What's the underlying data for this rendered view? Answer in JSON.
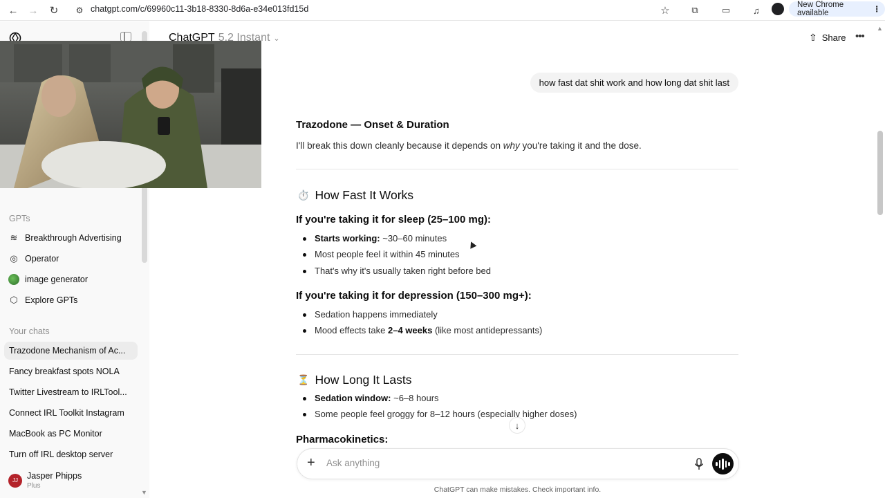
{
  "browser": {
    "url": "chatgpt.com/c/69960c11-3b18-8330-8d6a-e34e013fd15d",
    "new_chrome_label": "New Chrome available"
  },
  "sidebar": {
    "gpts_heading": "GPTs",
    "gpts": [
      {
        "label": "Breakthrough Advertising",
        "icon": "advertising-gpt-icon"
      },
      {
        "label": "Operator",
        "icon": "operator-icon"
      },
      {
        "label": "image generator",
        "icon": "image-generator-icon"
      },
      {
        "label": "Explore GPTs",
        "icon": "explore-gpts-icon"
      }
    ],
    "chats_heading": "Your chats",
    "chats": [
      "Trazodone Mechanism of Ac...",
      "Fancy breakfast spots NOLA",
      "Twitter Livestream to IRLTool...",
      "Connect IRL Toolkit Instagram",
      "MacBook as PC Monitor",
      "Turn off IRL desktop server"
    ],
    "user": {
      "initials": "JJ",
      "name": "Jasper Phipps",
      "plan": "Plus"
    }
  },
  "header": {
    "model_name": "ChatGPT",
    "model_version": "5.2 Instant",
    "share_label": "Share"
  },
  "conversation": {
    "user_message": "how fast dat shit work and how long dat shit last",
    "title": "Trazodone — Onset & Duration",
    "intro_before": "I'll break this down cleanly because it depends on ",
    "intro_emph": "why",
    "intro_after": " you're taking it and the dose.",
    "section1": {
      "emoji": "⏱️",
      "heading": "How Fast It Works",
      "sleep_heading": "If you're taking it for sleep (25–100 mg):",
      "sleep_items": [
        {
          "bold": "Starts working:",
          "text": " ~30–60 minutes"
        },
        {
          "bold": "",
          "text": "Most people feel it within 45 minutes"
        },
        {
          "bold": "",
          "text": "That's why it's usually taken right before bed"
        }
      ],
      "dep_heading": "If you're taking it for depression (150–300 mg+):",
      "dep_item1": "Sedation happens immediately",
      "dep_item2_before": "Mood effects take ",
      "dep_item2_bold": "2–4 weeks",
      "dep_item2_after": " (like most antidepressants)"
    },
    "section2": {
      "emoji": "⏳",
      "heading": "How Long It Lasts",
      "items": [
        {
          "bold": "Sedation window:",
          "text": " ~6–8 hours"
        },
        {
          "bold": "",
          "text": "Some people feel groggy for 8–12 hours (especially higher doses)"
        }
      ],
      "pk_heading": "Pharmacokinetics:"
    }
  },
  "composer": {
    "placeholder": "Ask anything",
    "disclaimer": "ChatGPT can make mistakes. Check important info."
  },
  "colors": {
    "sidebar_bg": "#f9f9f9",
    "bubble_bg": "#f3f3f3",
    "active_chat_bg": "#ececec",
    "avatar": "#b4232a",
    "new_chrome_pill": "#e8f0fe"
  }
}
